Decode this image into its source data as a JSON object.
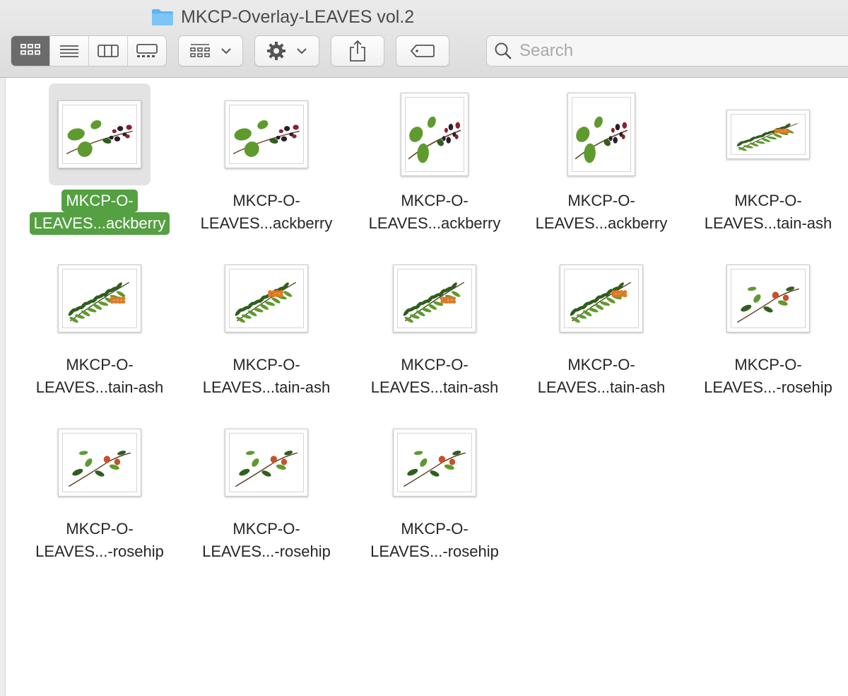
{
  "window": {
    "title": "MKCP-Overlay-LEAVES vol.2",
    "folder_icon": "folder-icon"
  },
  "toolbar": {
    "view_modes": [
      {
        "name": "icon-view",
        "icon": "grid-icon",
        "active": true
      },
      {
        "name": "list-view",
        "icon": "list-icon",
        "active": false
      },
      {
        "name": "column-view",
        "icon": "columns-icon",
        "active": false
      },
      {
        "name": "gallery-view",
        "icon": "gallery-icon",
        "active": false
      }
    ],
    "group_button_icon": "group-grid-icon",
    "action_button_icon": "gear-icon",
    "share_button_icon": "share-icon",
    "tag_button_icon": "tag-icon",
    "search": {
      "placeholder": "Search",
      "value": ""
    }
  },
  "files": [
    {
      "line1": "MKCP-O-",
      "line2": "LEAVES...ackberry",
      "plant": "blackberry",
      "orient": "landscape",
      "selected": true
    },
    {
      "line1": "MKCP-O-",
      "line2": "LEAVES...ackberry",
      "plant": "blackberry",
      "orient": "landscape",
      "selected": false
    },
    {
      "line1": "MKCP-O-",
      "line2": "LEAVES...ackberry",
      "plant": "blackberry",
      "orient": "portrait",
      "selected": false
    },
    {
      "line1": "MKCP-O-",
      "line2": "LEAVES...ackberry",
      "plant": "blackberry",
      "orient": "portrait",
      "selected": false
    },
    {
      "line1": "MKCP-O-",
      "line2": "LEAVES...tain-ash",
      "plant": "mountain-ash",
      "orient": "wide",
      "selected": false
    },
    {
      "line1": "MKCP-O-",
      "line2": "LEAVES...tain-ash",
      "plant": "mountain-ash",
      "orient": "landscape",
      "selected": false
    },
    {
      "line1": "MKCP-O-",
      "line2": "LEAVES...tain-ash",
      "plant": "mountain-ash",
      "orient": "landscape",
      "selected": false
    },
    {
      "line1": "MKCP-O-",
      "line2": "LEAVES...tain-ash",
      "plant": "mountain-ash",
      "orient": "landscape",
      "selected": false
    },
    {
      "line1": "MKCP-O-",
      "line2": "LEAVES...tain-ash",
      "plant": "mountain-ash",
      "orient": "square",
      "selected": false
    },
    {
      "line1": "MKCP-O-",
      "line2": "LEAVES...-rosehip",
      "plant": "rosehip",
      "orient": "landscape",
      "selected": false
    },
    {
      "line1": "MKCP-O-",
      "line2": "LEAVES...-rosehip",
      "plant": "rosehip",
      "orient": "landscape",
      "selected": false
    },
    {
      "line1": "MKCP-O-",
      "line2": "LEAVES...-rosehip",
      "plant": "rosehip",
      "orient": "landscape",
      "selected": false
    },
    {
      "line1": "MKCP-O-",
      "line2": "LEAVES...-rosehip",
      "plant": "rosehip",
      "orient": "square",
      "selected": false
    }
  ],
  "colors": {
    "selection": "#55a042",
    "leaf": "#5f9a2e",
    "leaf_dark": "#2f5e1d",
    "blackberry": "#2a1e2a",
    "blackberry_red": "#8a2030",
    "rowan": "#e07a25",
    "rosehip": "#c8502a"
  }
}
